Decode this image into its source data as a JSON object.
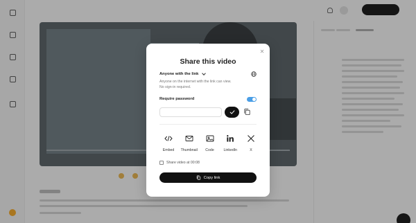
{
  "modal": {
    "title": "Share this video",
    "access": {
      "label": "Anyone with the link",
      "description_line1": "Anyone on the internet with the link can view.",
      "description_line2": "No sign-in required."
    },
    "password": {
      "label": "Require password",
      "enabled": true,
      "value": "",
      "placeholder": ""
    },
    "share_options": [
      {
        "icon": "code-brackets-icon",
        "label": "Embed"
      },
      {
        "icon": "mail-icon",
        "label": "Thumbnail"
      },
      {
        "icon": "image-icon",
        "label": "Code"
      },
      {
        "icon": "linkedin-icon",
        "label": "LinkedIn"
      },
      {
        "icon": "x-logo-icon",
        "label": "X"
      }
    ],
    "timestamp_option": {
      "label": "Share video at 00:08",
      "checked": false
    },
    "copy_button": {
      "label": "Copy link"
    }
  },
  "colors": {
    "accent": "#111111",
    "toggle_on": "#4a9ee6",
    "overlay": "rgba(30,30,30,0.35)"
  }
}
